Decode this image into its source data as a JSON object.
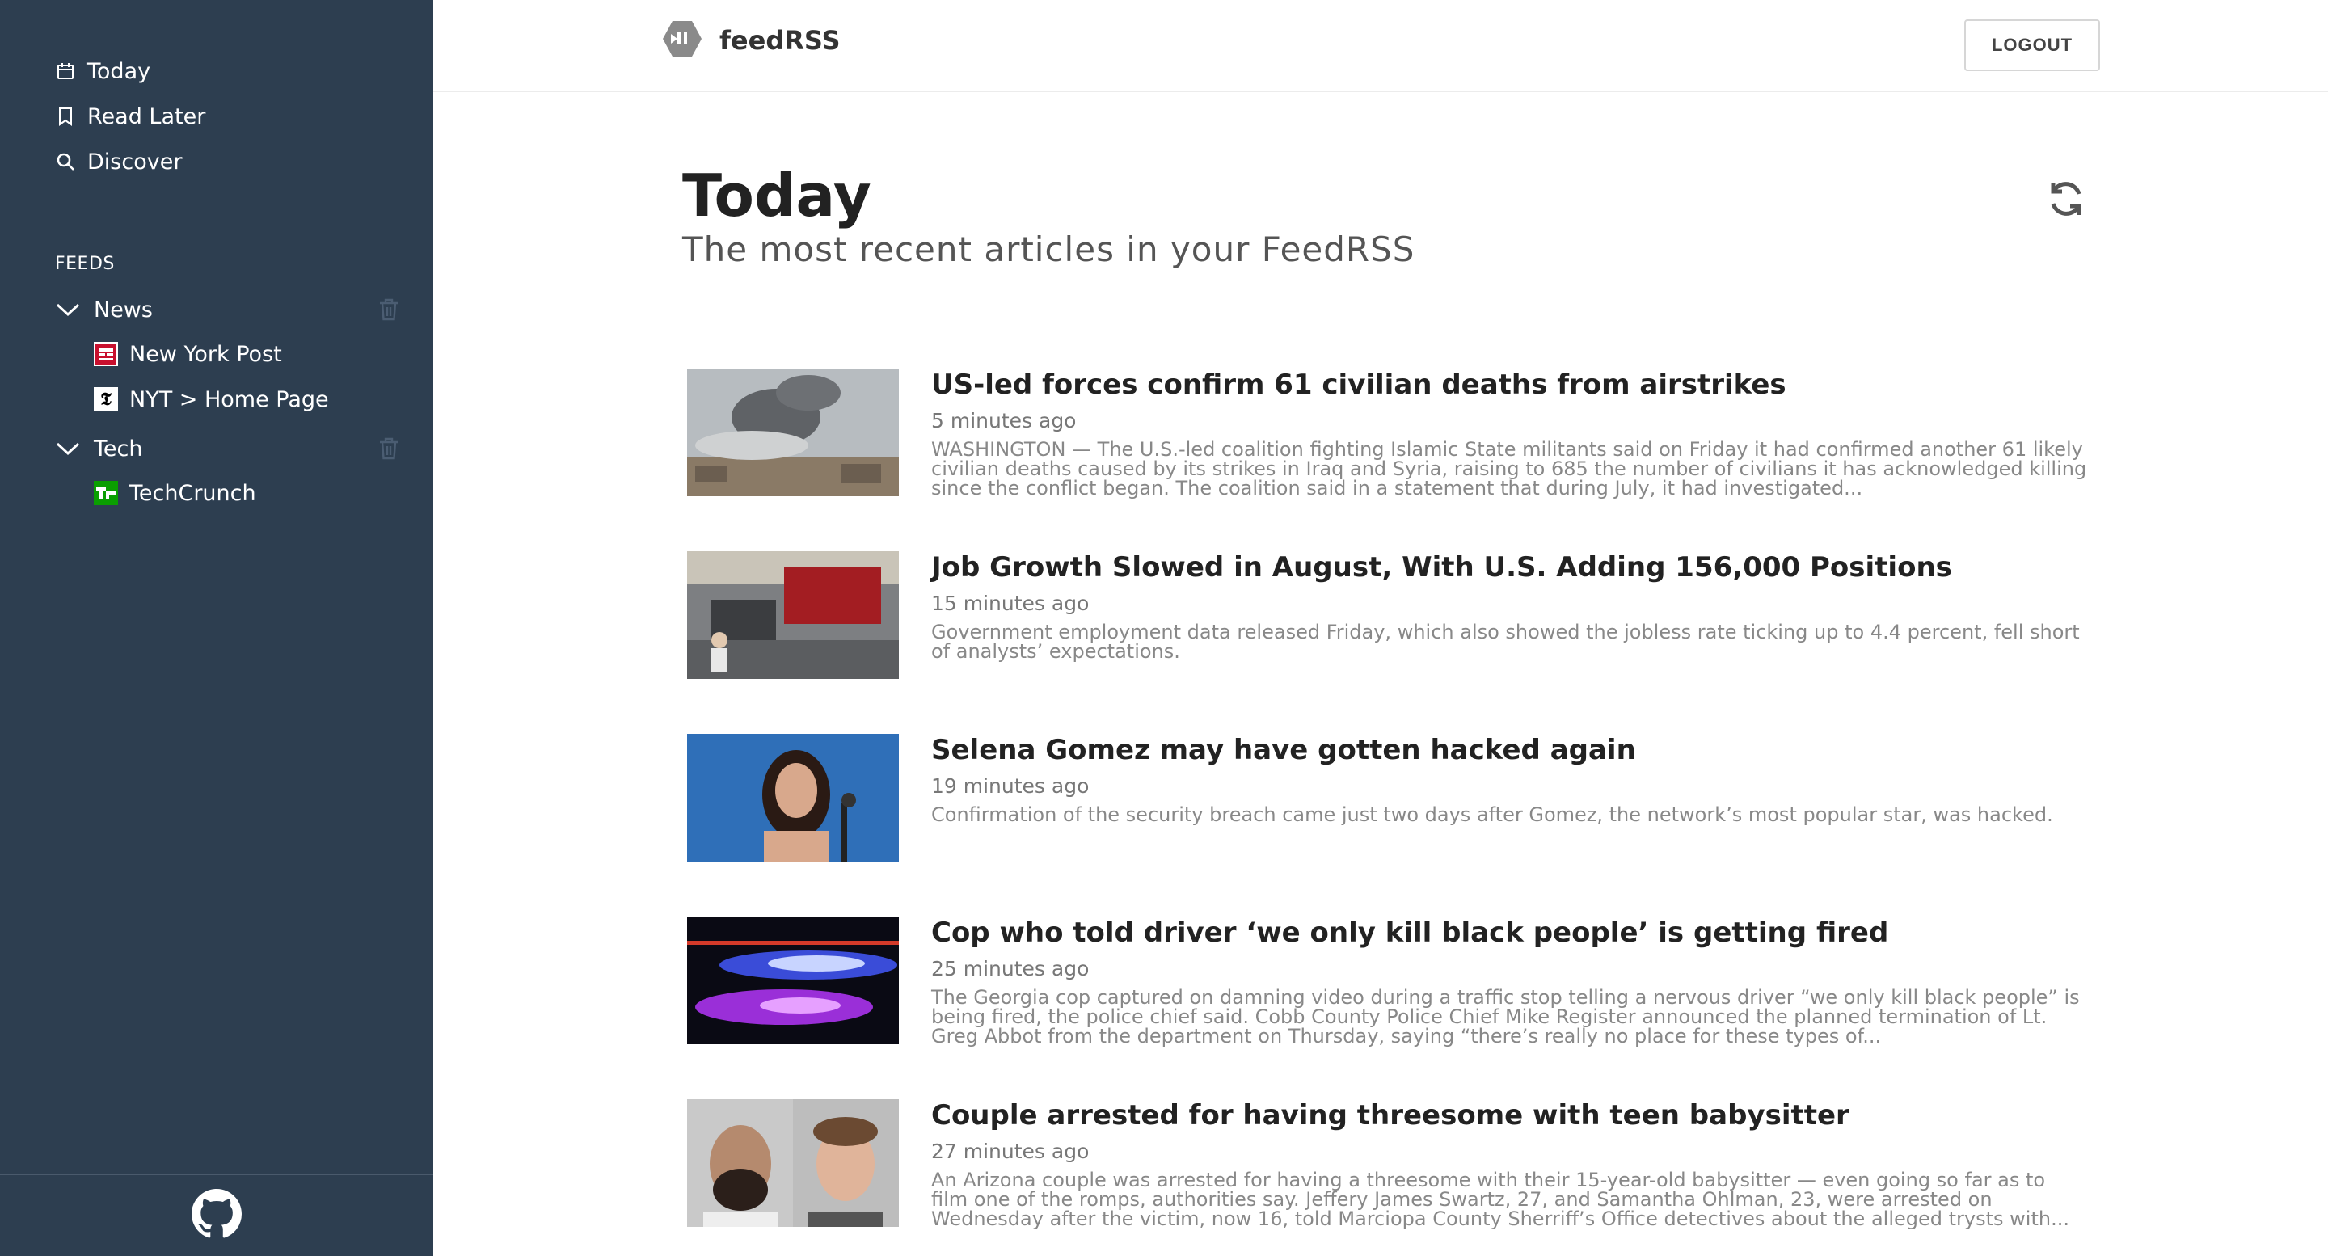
{
  "sidebar": {
    "nav": [
      {
        "label": "Today",
        "icon": "calendar-icon"
      },
      {
        "label": "Read Later",
        "icon": "bookmark-icon"
      },
      {
        "label": "Discover",
        "icon": "search-icon"
      }
    ],
    "feeds_heading": "FEEDS",
    "groups": [
      {
        "label": "News",
        "feeds": [
          {
            "label": "New York Post",
            "icon": "new-york-post-favicon"
          },
          {
            "label": "NYT > Home Page",
            "icon": "nyt-favicon"
          }
        ]
      },
      {
        "label": "Tech",
        "feeds": [
          {
            "label": "TechCrunch",
            "icon": "techcrunch-favicon"
          }
        ]
      }
    ],
    "footer_icon": "github-icon"
  },
  "header": {
    "brand": "feedRSS",
    "logout": "LOGOUT"
  },
  "main": {
    "title": "Today",
    "subtitle": "The most recent articles in your FeedRSS",
    "articles": [
      {
        "title": "US-led forces confirm 61 civilian deaths from airstrikes",
        "time": "5 minutes ago",
        "description": "WASHINGTON — The U.S.-led coalition fighting Islamic State militants said on Friday it had confirmed another 61 likely civilian deaths caused by its strikes in Iraq and Syria, raising to 685 the number of civilians it has acknowledged killing since the conflict began. The coalition said in a statement that during July, it had investigated..."
      },
      {
        "title": "Job Growth Slowed in August, With U.S. Adding 156,000 Positions",
        "time": "15 minutes ago",
        "description": "Government employment data released Friday, which also showed the jobless rate ticking up to 4.4 percent, fell short of analysts’ expectations."
      },
      {
        "title": "Selena Gomez may have gotten hacked again",
        "time": "19 minutes ago",
        "description": "Confirmation of the security breach came just two days after Gomez, the network’s most popular star, was hacked."
      },
      {
        "title": "Cop who told driver ‘we only kill black people’ is getting fired",
        "time": "25 minutes ago",
        "description": "The Georgia cop captured on damning video during a traffic stop telling a nervous driver “we only kill black people” is being fired, the police chief said. Cobb County Police Chief Mike Register announced the planned termination of Lt. Greg Abbot from the department on Thursday, saying “there’s really no place for these types of..."
      },
      {
        "title": "Couple arrested for having threesome with teen babysitter",
        "time": "27 minutes ago",
        "description": "An Arizona couple was arrested for having a threesome with their 15-year-old babysitter — even going so far as to film one of the romps, authorities say. Jeffery James Swartz, 27, and Samantha Ohlman, 23, were arrested on Wednesday after the victim, now 16, told Marciopa County Sherriff’s Office detectives about the alleged trysts with..."
      }
    ]
  },
  "colors": {
    "sidebar": "#2d3e50",
    "text": "#222222",
    "muted": "#888888"
  }
}
